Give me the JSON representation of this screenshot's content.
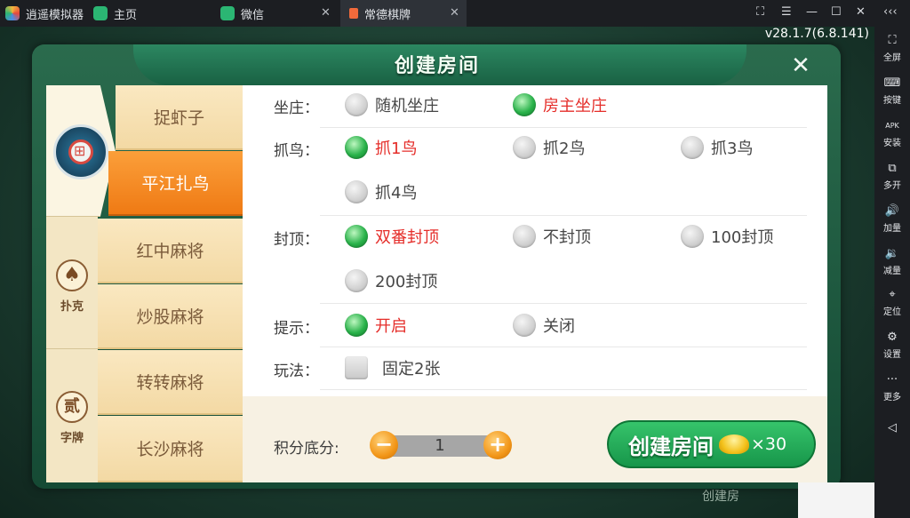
{
  "titlebar": {
    "tabs": [
      {
        "label": "逍遥模拟器",
        "icon": "logo-icon",
        "color": "#f3b73c"
      },
      {
        "label": "主页",
        "icon": "home-icon",
        "color": "#2bb673"
      },
      {
        "label": "微信",
        "icon": "wechat-icon",
        "color": "#2bb673"
      },
      {
        "label": "常德棋牌",
        "icon": "app-icon",
        "color": "#f06a3b"
      }
    ],
    "close_glyph": "✕",
    "window_controls": [
      "⛶",
      "—",
      "☐",
      "✕",
      "‹‹‹"
    ]
  },
  "version": "v28.1.7(6.8.141)",
  "sidebar": [
    {
      "label": "全屏",
      "icon": "⛶"
    },
    {
      "label": "按键",
      "icon": "⌨"
    },
    {
      "label": "安装",
      "icon": "APK"
    },
    {
      "label": "多开",
      "icon": "⧉"
    },
    {
      "label": "加量",
      "icon": "🔊"
    },
    {
      "label": "减量",
      "icon": "🔉"
    },
    {
      "label": "定位",
      "icon": "⌖"
    },
    {
      "label": "设置",
      "icon": "⚙"
    },
    {
      "label": "更多",
      "icon": "···"
    },
    {
      "label": "",
      "icon": "◁"
    }
  ],
  "dialog": {
    "title": "创建房间",
    "close_glyph": "✕",
    "categories": [
      {
        "label": "扑克",
        "glyph": "♠"
      },
      {
        "label": "字牌",
        "glyph": "贰"
      }
    ],
    "game_tabs": [
      "捉虾子",
      "平江扎鸟",
      "红中麻将",
      "炒股麻将",
      "转转麻将",
      "长沙麻将"
    ],
    "active_tab": "平江扎鸟",
    "rows": {
      "zuozhuang": {
        "label": "坐庄：",
        "options": [
          {
            "text": "随机坐庄",
            "selected": false
          },
          {
            "text": "房主坐庄",
            "selected": true
          }
        ]
      },
      "zhuaniao": {
        "label": "抓鸟：",
        "options": [
          {
            "text": "抓1鸟",
            "selected": true
          },
          {
            "text": "抓2鸟",
            "selected": false
          },
          {
            "text": "抓3鸟",
            "selected": false
          },
          {
            "text": "抓4鸟",
            "selected": false
          }
        ]
      },
      "fengding": {
        "label": "封顶：",
        "options": [
          {
            "text": "双番封顶",
            "selected": true
          },
          {
            "text": "不封顶",
            "selected": false
          },
          {
            "text": "100封顶",
            "selected": false
          },
          {
            "text": "200封顶",
            "selected": false
          }
        ]
      },
      "tishi": {
        "label": "提示：",
        "options": [
          {
            "text": "开启",
            "selected": true
          },
          {
            "text": "关闭",
            "selected": false
          }
        ]
      },
      "wanfa": {
        "label": "玩法：",
        "checkbox": {
          "text": "固定2张",
          "checked": false
        }
      }
    },
    "score": {
      "label": "积分底分:",
      "value": "1",
      "minus": "−",
      "plus": "+"
    },
    "create": {
      "label": "创建房间",
      "cost": "×30"
    }
  },
  "background": {
    "bottom_label": "创建房"
  },
  "colors": {
    "selected_text": "#e52e2a",
    "active_tab": "#f58a22",
    "green_button": "#22a955"
  }
}
